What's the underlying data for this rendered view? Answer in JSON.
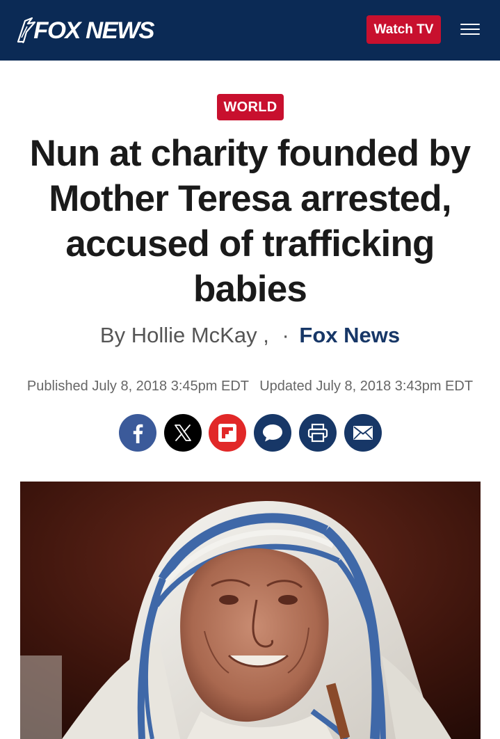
{
  "header": {
    "logo_text": "FOX NEWS",
    "watch_tv_label": "Watch TV",
    "menu_icon": "hamburger-menu-icon",
    "background_color": "#0b2a55",
    "accent_color": "#c8102e"
  },
  "article": {
    "category": "WORLD",
    "headline": "Nun at charity founded by Mother Teresa arrested, accused of trafficking babies",
    "byline": {
      "prefix": "By",
      "author": "Hollie McKay ,",
      "separator": "·",
      "source": "Fox News"
    },
    "published": "Published July 8, 2018 3:45pm EDT",
    "updated": "Updated July 8, 2018 3:43pm EDT",
    "share": [
      {
        "name": "facebook",
        "icon": "facebook-icon",
        "color": "#3b5a9a"
      },
      {
        "name": "x",
        "icon": "x-icon",
        "color": "#000000"
      },
      {
        "name": "flipboard",
        "icon": "flipboard-icon",
        "color": "#e12828"
      },
      {
        "name": "comments",
        "icon": "comment-icon",
        "color": "#173767"
      },
      {
        "name": "print",
        "icon": "print-icon",
        "color": "#173767"
      },
      {
        "name": "email",
        "icon": "email-icon",
        "color": "#173767"
      }
    ]
  }
}
